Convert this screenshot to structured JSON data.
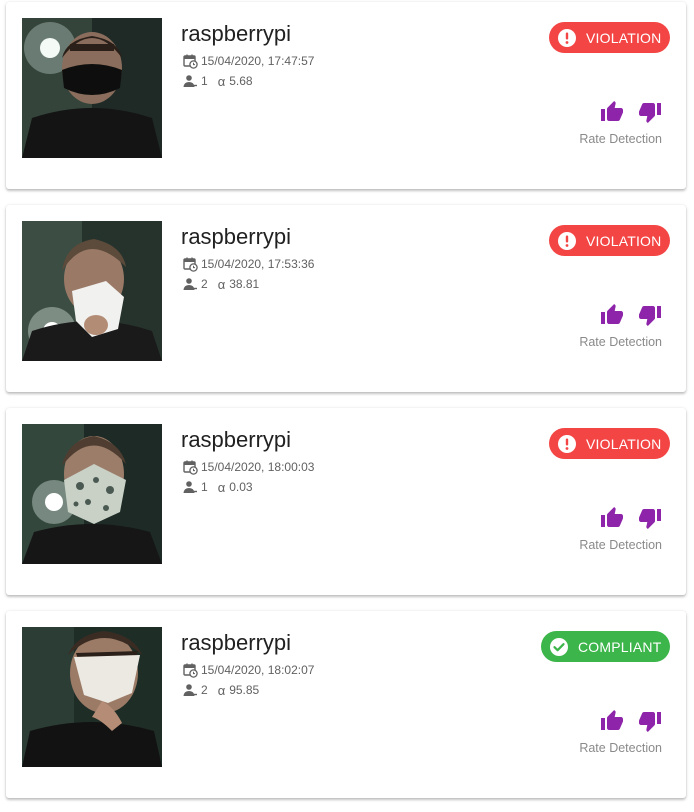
{
  "colors": {
    "violation": "#f44545",
    "compliant": "#3cb54a",
    "rating_icon": "#8e24aa",
    "meta_text": "#616161"
  },
  "detections": [
    {
      "device": "raspberrypi",
      "timestamp": "15/04/2020, 17:47:57",
      "persons": "1",
      "alpha": "5.68",
      "status": "VIOLATION",
      "status_type": "violation",
      "rate_label": "Rate Detection",
      "thumbnail": "person-black-mask"
    },
    {
      "device": "raspberrypi",
      "timestamp": "15/04/2020, 17:53:36",
      "persons": "2",
      "alpha": "38.81",
      "status": "VIOLATION",
      "status_type": "violation",
      "rate_label": "Rate Detection",
      "thumbnail": "person-tissue"
    },
    {
      "device": "raspberrypi",
      "timestamp": "15/04/2020, 18:00:03",
      "persons": "1",
      "alpha": "0.03",
      "status": "VIOLATION",
      "status_type": "violation",
      "rate_label": "Rate Detection",
      "thumbnail": "person-patterned-mask"
    },
    {
      "device": "raspberrypi",
      "timestamp": "15/04/2020, 18:02:07",
      "persons": "2",
      "alpha": "95.85",
      "status": "COMPLIANT",
      "status_type": "compliant",
      "rate_label": "Rate Detection",
      "thumbnail": "person-white-mask"
    }
  ]
}
